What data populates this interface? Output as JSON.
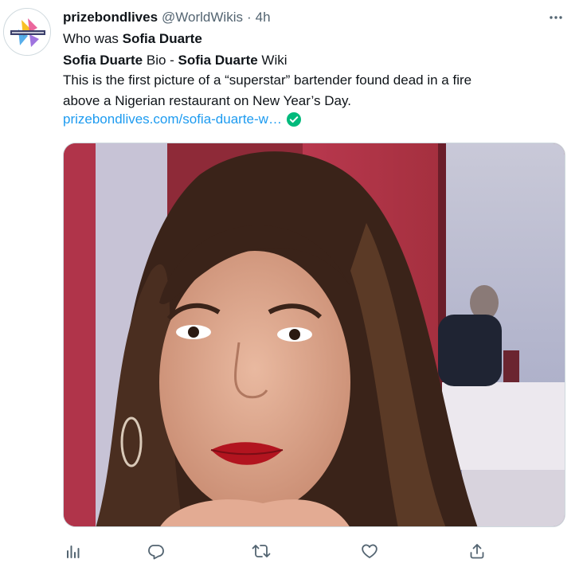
{
  "tweet": {
    "display_name": "prizebondlives",
    "handle": "@WorldWikis",
    "separator": "·",
    "time": "4h",
    "line1": {
      "prefix": "Who was ",
      "name": "Sofia Duarte"
    },
    "line2": {
      "name1": "Sofia Duarte",
      "mid": " Bio - ",
      "name2": "Sofia Duarte",
      "suffix": " Wiki"
    },
    "line3": "This is the first picture of a “superstar” bartender found dead in a fire",
    "line4": "above a Nigerian restaurant on New Year’s Day.",
    "link_text": "prizebondlives.com/sofia-duarte-w…"
  },
  "icons": {
    "more": "more-horizontal-icon",
    "verified": "verified-check-icon",
    "views": "analytics-icon",
    "reply": "reply-icon",
    "retweet": "retweet-icon",
    "like": "like-icon",
    "share": "share-icon"
  },
  "colors": {
    "text": "#0f1419",
    "secondary": "#536471",
    "link": "#1d9bf0",
    "verified": "#00ba7c"
  }
}
